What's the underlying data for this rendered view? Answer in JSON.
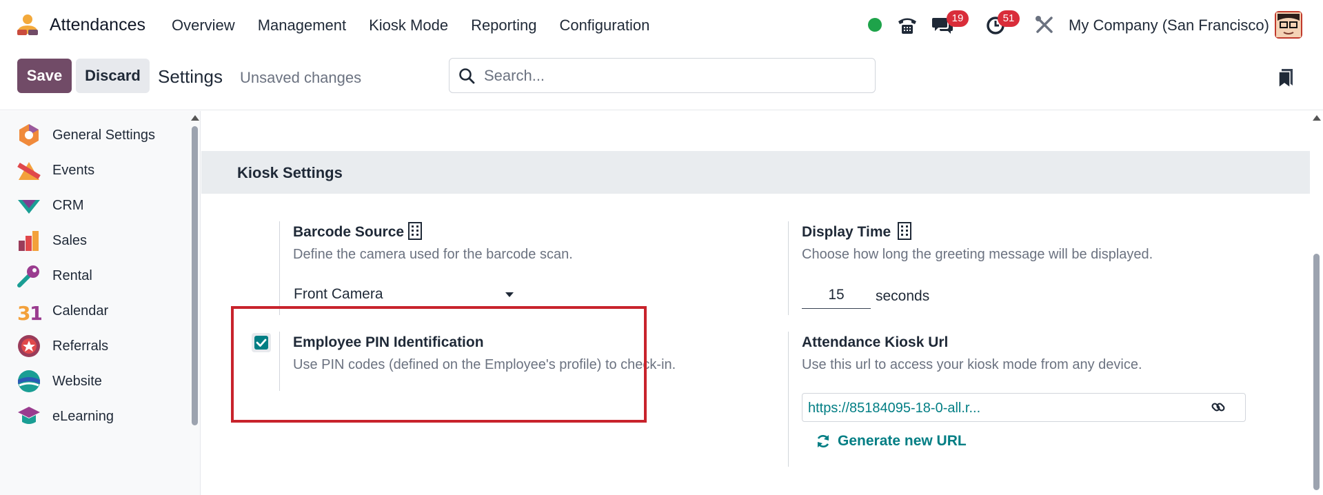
{
  "app": {
    "title": "Attendances",
    "icon": "attendances-app-icon",
    "menu": [
      "Overview",
      "Management",
      "Kiosk Mode",
      "Reporting",
      "Configuration"
    ]
  },
  "systray": {
    "status": "online",
    "status_color": "#1ea34a",
    "icons": [
      "phone-icon",
      "chat-icon",
      "activity-clock-icon",
      "debug-tools-icon"
    ],
    "messages_badge": "19",
    "activities_badge": "51",
    "company": "My Company (San Francisco)"
  },
  "control": {
    "save_label": "Save",
    "discard_label": "Discard",
    "title": "Settings",
    "status": "Unsaved changes",
    "search_placeholder": "Search..."
  },
  "sidebar": {
    "items": [
      {
        "label": "General Settings",
        "icon": "general-settings-icon"
      },
      {
        "label": "Events",
        "icon": "events-icon"
      },
      {
        "label": "CRM",
        "icon": "crm-icon"
      },
      {
        "label": "Sales",
        "icon": "sales-icon"
      },
      {
        "label": "Rental",
        "icon": "rental-icon"
      },
      {
        "label": "Calendar",
        "icon": "calendar-icon"
      },
      {
        "label": "Referrals",
        "icon": "referrals-icon"
      },
      {
        "label": "Website",
        "icon": "website-icon"
      },
      {
        "label": "eLearning",
        "icon": "elearning-icon"
      }
    ]
  },
  "kiosk": {
    "section_title": "Kiosk Settings",
    "barcode": {
      "title": "Barcode Source",
      "desc": "Define the camera used for the barcode scan.",
      "value": "Front Camera"
    },
    "display": {
      "title": "Display Time",
      "desc": "Choose how long the greeting message will be displayed.",
      "value": "15",
      "unit": "seconds"
    },
    "pin": {
      "title": "Employee PIN Identification",
      "desc": "Use PIN codes (defined on the Employee's profile) to check-in.",
      "checked": true
    },
    "url": {
      "title": "Attendance Kiosk Url",
      "desc": "Use this url to access your kiosk mode from any device.",
      "value": "https://85184095-18-0-all.r...",
      "generate_label": "Generate new URL"
    }
  },
  "colors": {
    "brand": "#714b67",
    "accent": "#017e84",
    "highlight": "#c8232c",
    "badge": "#d92d3a"
  }
}
